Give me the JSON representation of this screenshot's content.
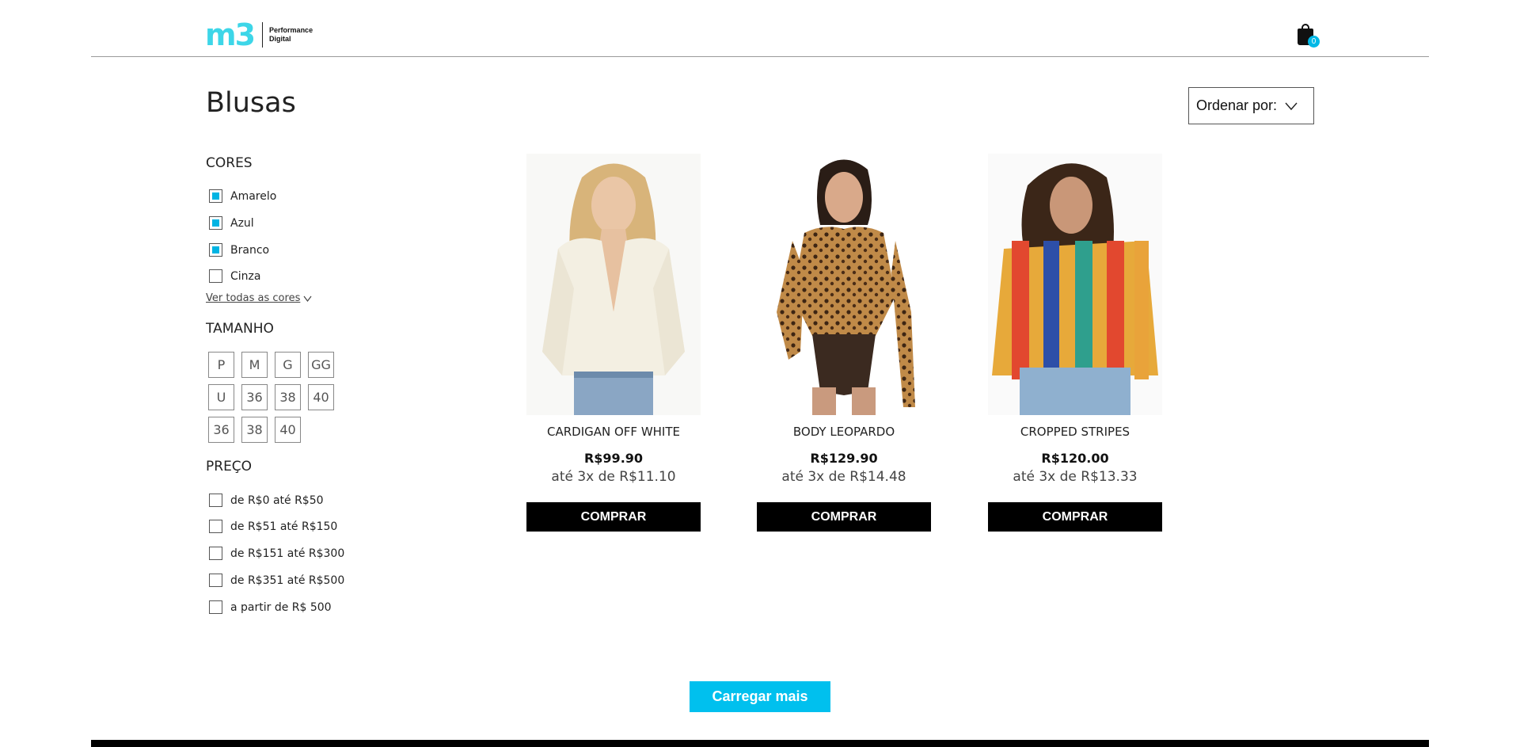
{
  "header": {
    "logo_main": "m3",
    "logo_line1": "Performance",
    "logo_line2": "Digital",
    "cart_count": "0",
    "cart_icon": "shopping-bag-icon"
  },
  "page_title": "Blusas",
  "sort": {
    "label": "Ordenar por:",
    "icon": "chevron-down-icon"
  },
  "filters": {
    "colors": {
      "title": "CORES",
      "items": [
        {
          "label": "Amarelo",
          "checked": true
        },
        {
          "label": "Azul",
          "checked": true
        },
        {
          "label": "Branco",
          "checked": true
        },
        {
          "label": "Cinza",
          "checked": false
        }
      ],
      "see_all": "Ver todas as cores"
    },
    "sizes": {
      "title": "TAMANHO",
      "rows": [
        [
          "P",
          "M",
          "G",
          "GG"
        ],
        [
          "U",
          "36",
          "38",
          "40"
        ],
        [
          "36",
          "38",
          "40"
        ]
      ]
    },
    "price": {
      "title": "PREÇO",
      "items": [
        {
          "label": "de R$0 até R$50",
          "checked": false
        },
        {
          "label": "de R$51 até R$150",
          "checked": false
        },
        {
          "label": "de R$151 até R$300",
          "checked": false
        },
        {
          "label": "de R$351 até R$500",
          "checked": false
        },
        {
          "label": "a partir de R$ 500",
          "checked": false
        }
      ]
    }
  },
  "products": [
    {
      "name": "CARDIGAN OFF WHITE",
      "price": "R$99.90",
      "installments": "até 3x de R$11.10",
      "buy_label": "COMPRAR"
    },
    {
      "name": "BODY LEOPARDO",
      "price": "R$129.90",
      "installments": "até 3x de R$14.48",
      "buy_label": "COMPRAR"
    },
    {
      "name": "CROPPED STRIPES",
      "price": "R$120.00",
      "installments": "até 3x de R$13.33",
      "buy_label": "COMPRAR"
    }
  ],
  "load_more": "Carregar mais",
  "colors": {
    "accent": "#00c0ee",
    "logo": "#3dd6e8",
    "button": "#000000"
  }
}
